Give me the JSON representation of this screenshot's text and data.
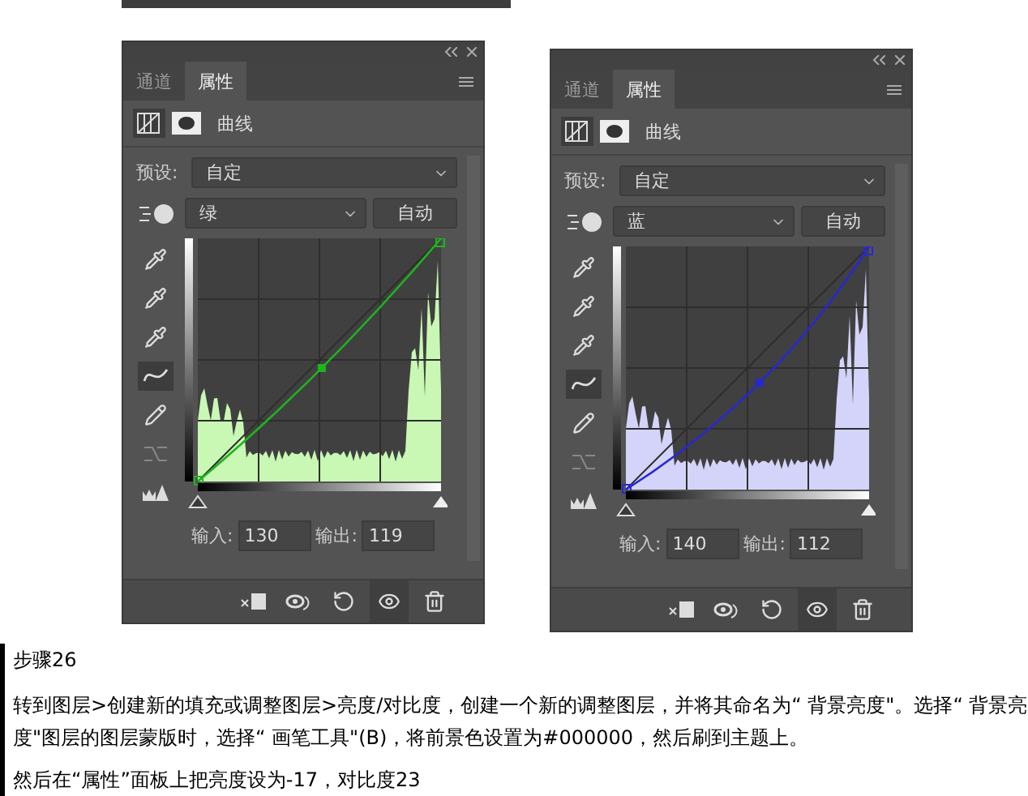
{
  "panels": [
    {
      "tabs": [
        {
          "label": "通道",
          "selected": false
        },
        {
          "label": "属性",
          "selected": true
        }
      ],
      "title": "曲线",
      "preset_label": "预设:",
      "preset": "自定",
      "channel": "绿",
      "auto_button": "自动",
      "kind": "green",
      "shadow_slider": {
        "level": 0
      },
      "highlight_slider": {
        "level": 1
      },
      "input_label": "输入:",
      "input": "130",
      "output_label": "输出:",
      "output": "119"
    },
    {
      "tabs": [
        {
          "label": "通道",
          "selected": false
        },
        {
          "label": "属性",
          "selected": true
        }
      ],
      "title": "曲线",
      "preset_label": "预设:",
      "preset": "自定",
      "channel": "蓝",
      "auto_button": "自动",
      "kind": "blue",
      "shadow_slider": {
        "level": 0
      },
      "highlight_slider": {
        "level": 1
      },
      "input_label": "输入:",
      "input": "140",
      "output_label": "输出:",
      "output": "112"
    }
  ],
  "step_title": "步骤26",
  "paragraph": "转到图层>创建新的填充或调整图层>亮度/对比度，创建一个新的调整图层，并将其命名为“ 背景亮度\"。选择“ 背景亮度\"图层的图层蒙版时，选择“ 画笔工具\"(B)，将前景色设置为#000000，然后刷到主题上。",
  "next_paragraph": "然后在“属性”面板上把亮度设为-17，对比度23"
}
